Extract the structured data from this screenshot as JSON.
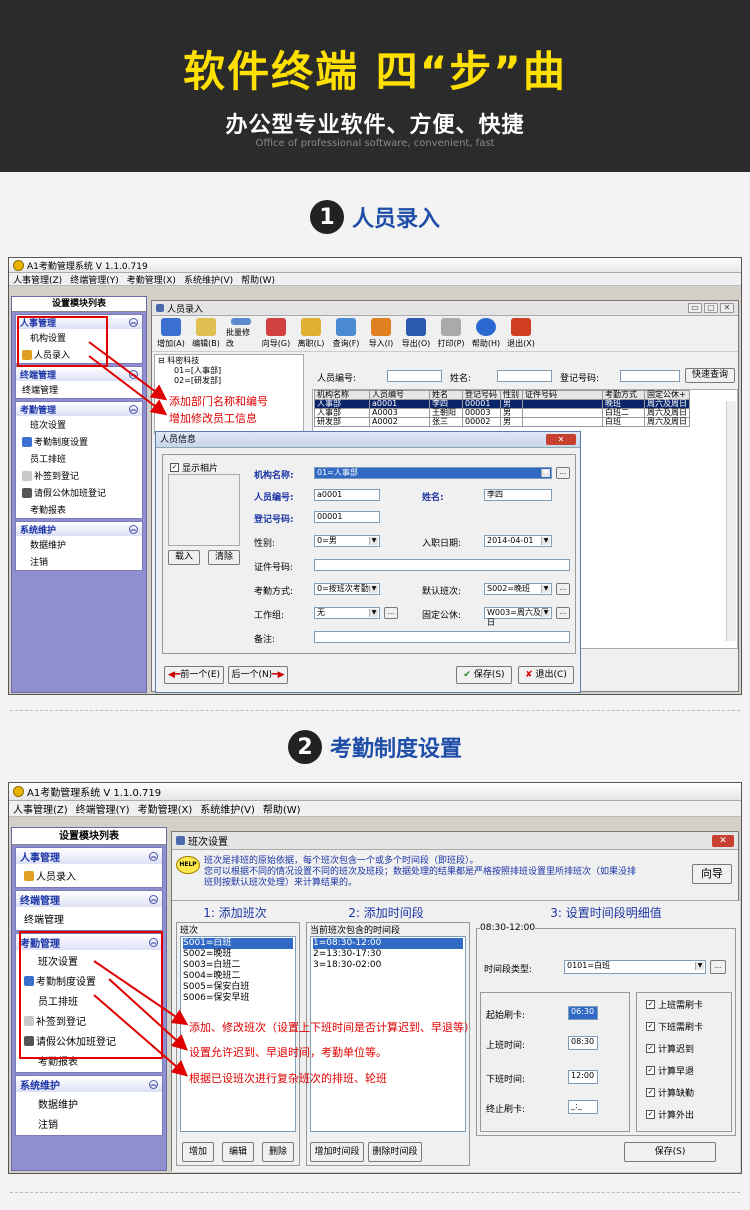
{
  "hero": {
    "title": "软件终端 四“步”曲",
    "subtitle": "办公型专业软件、方便、快捷",
    "subtitle_en": "Office of professional software, convenient, fast"
  },
  "steps": [
    {
      "num": "1",
      "label": "人员录入"
    },
    {
      "num": "2",
      "label": "考勤制度设置"
    }
  ],
  "app": {
    "title": "A1考勤管理系统 V 1.1.0.719",
    "menu": [
      "人事管理(Z)",
      "终端管理(Y)",
      "考勤管理(X)",
      "系统维护(V)",
      "帮助(W)"
    ]
  },
  "sidebar": {
    "header": "设置模块列表",
    "groups": [
      {
        "title": "人事管理",
        "items": [
          "机构设置",
          "人员录入"
        ]
      },
      {
        "title": "终端管理",
        "items": [
          "终端管理"
        ]
      },
      {
        "title": "考勤管理",
        "items": [
          "班次设置",
          "考勤制度设置",
          "员工排班",
          "补签到登记",
          "请假公休加班登记",
          "考勤报表"
        ]
      },
      {
        "title": "系统维护",
        "items": [
          "数据维护",
          "注销"
        ]
      }
    ]
  },
  "s1": {
    "window_title": "人员录入",
    "toolbar": [
      "增加(A)",
      "编辑(B)",
      "批量修改",
      "向导(G)",
      "离职(L)",
      "查询(F)",
      "导入(I)",
      "导出(O)",
      "打印(P)",
      "帮助(H)",
      "退出(X)"
    ],
    "tree": [
      "科密科技",
      "01=[人事部]",
      "02=[研发部]"
    ],
    "search": {
      "emp_no": "人员编号:",
      "name": "姓名:",
      "reg_no": "登记号码:",
      "query": "快速查询"
    },
    "grid": {
      "headers": [
        "机构名称",
        "人员编号",
        "姓名",
        "登记号码",
        "性别",
        "证件号码",
        "考勤方式",
        "固定公休+"
      ],
      "rows": [
        [
          "人事部",
          "a0001",
          "李四",
          "00001",
          "男",
          "",
          "晚班",
          "周六及周日"
        ],
        [
          "人事部",
          "A0003",
          "王朝阳",
          "00003",
          "男",
          "",
          "白班二",
          "周六及周日"
        ],
        [
          "研发部",
          "A0002",
          "张三",
          "00002",
          "男",
          "",
          "白班",
          "周六及周日"
        ]
      ]
    },
    "annotations": [
      "添加部门名称和编号",
      "增加修改员工信息"
    ],
    "dialog": {
      "title": "人员信息",
      "show_photo": "显示相片",
      "load": "载入",
      "clear": "清除",
      "org_label": "机构名称:",
      "org_value": "01=人事部",
      "emp_no_label": "人员编号:",
      "emp_no_value": "a0001",
      "name_label": "姓名:",
      "name_value": "李四",
      "reg_label": "登记号码:",
      "reg_value": "00001",
      "sex_label": "性别:",
      "sex_value": "0=男",
      "date_label": "入职日期:",
      "date_value": "2014-04-01",
      "id_label": "证件号码:",
      "att_label": "考勤方式:",
      "att_value": "0=按班次考勤",
      "shift_label": "默认班次:",
      "shift_value": "S002=晚班",
      "grp_label": "工作组:",
      "grp_value": "无",
      "rest_label": "固定公休:",
      "rest_value": "W003=周六及周日",
      "memo_label": "备注:",
      "prev": "前一个(E)",
      "next": "后一个(N)",
      "save": "保存(S)",
      "exit": "退出(C)"
    }
  },
  "s2": {
    "window_title": "班次设置",
    "help_text": [
      "班次是排班的原始依据，每个班次包含一个或多个时间段（即班段）。",
      "您可以根据不同的情况设置不同的班次及班段；数据处理的结果都是严格按照排班设置里所排班次（如果没排",
      "班则按默认班次处理）来计算结果的。"
    ],
    "wizard": "向导",
    "col1_title": "1: 添加班次",
    "col2_title": "2: 添加时间段",
    "col3_title": "3: 设置时间段明细值",
    "shift_box": "班次",
    "shifts": [
      "S001=白班",
      "S002=晚班",
      "S003=白班二",
      "S004=晚班二",
      "S005=保安白班",
      "S006=保安早班"
    ],
    "period_box": "当前班次包含的时间段",
    "periods": [
      "1=08:30-12:00",
      "2=13:30-17:30",
      "3=18:30-02:00"
    ],
    "detail_box": "08:30-12:00",
    "period_type_label": "时间段类型:",
    "period_type_value": "0101=白班",
    "start_card_label": "起始刷卡:",
    "start_card_value": "06:30",
    "on_label": "上班时间:",
    "on_value": "08:30",
    "off_label": "下班时间:",
    "off_value": "12:00",
    "end_card_label": "终止刷卡:",
    "end_card_value": "_:_",
    "checks": [
      "上班需刷卡",
      "下班需刷卡",
      "计算迟到",
      "计算早退",
      "计算缺勤",
      "计算外出"
    ],
    "btn_add": "增加",
    "btn_edit": "编辑",
    "btn_del": "删除",
    "btn_add_period": "增加时间段",
    "btn_del_period": "删除时间段",
    "btn_save": "保存(S)",
    "annotations": [
      "添加、修改班次（设置上下班时间是否计算迟到、早退等）",
      "设置允许迟到、早退时间，考勤单位等。",
      "根据已设班次进行复杂班次的排班、轮班"
    ]
  },
  "colors": {
    "hero_bg": "#2b2b2b",
    "title_yellow": "#ffe000",
    "step_blue": "#1f4ea8",
    "annot_red": "#e00000",
    "sidebar_bg": "#8f8fd0"
  }
}
